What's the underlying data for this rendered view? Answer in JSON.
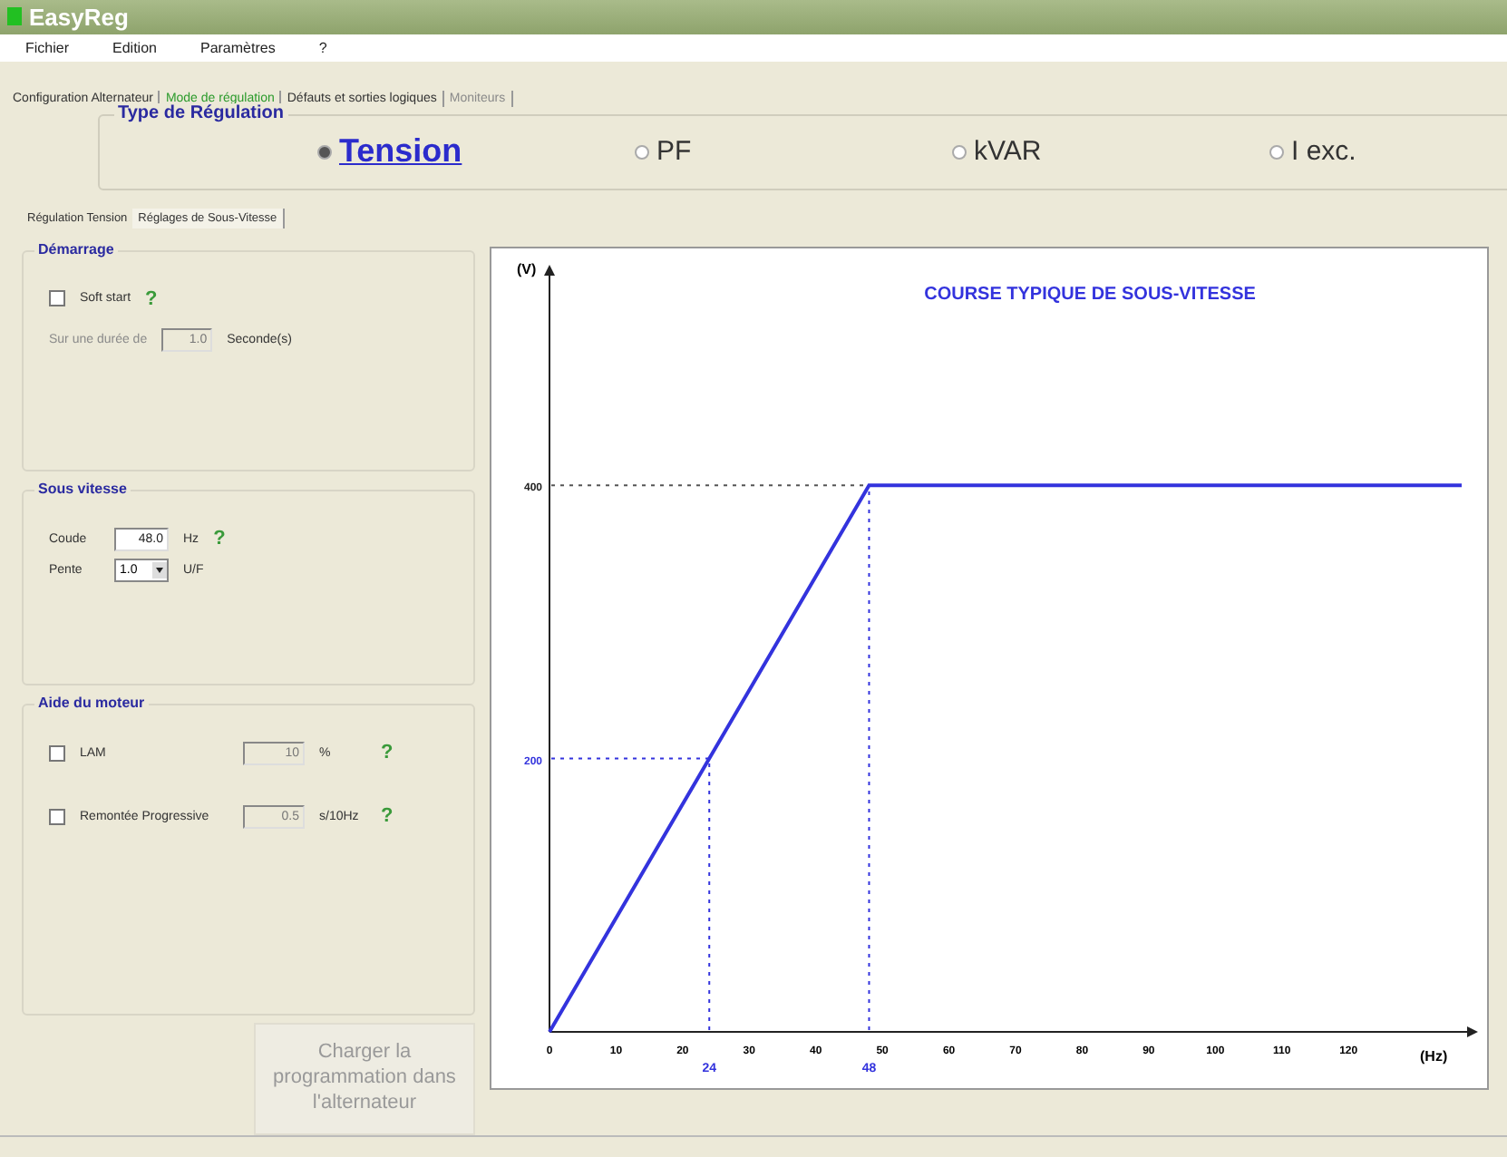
{
  "window": {
    "title": "EasyReg"
  },
  "menu": [
    "Fichier",
    "Edition",
    "Paramètres",
    "?"
  ],
  "tabs": [
    {
      "label": "Configuration Alternateur",
      "selected": false,
      "disabled": false
    },
    {
      "label": "Mode de régulation",
      "selected": true,
      "disabled": false
    },
    {
      "label": "Défauts et sorties logiques",
      "selected": false,
      "disabled": false
    },
    {
      "label": "Moniteurs",
      "selected": false,
      "disabled": true
    }
  ],
  "regulation_type": {
    "title": "Type de Régulation",
    "options": [
      {
        "label": "Tension",
        "selected": true
      },
      {
        "label": "PF",
        "selected": false
      },
      {
        "label": "kVAR",
        "selected": false
      },
      {
        "label": "I exc.",
        "selected": false
      }
    ]
  },
  "subtabs": [
    {
      "label": "Régulation Tension",
      "selected": false
    },
    {
      "label": "Réglages de Sous-Vitesse",
      "selected": true
    }
  ],
  "demarrage": {
    "title": "Démarrage",
    "soft_start": {
      "label": "Soft start",
      "checked": false
    },
    "help": "?",
    "duration_label": "Sur une durée de",
    "duration_value": "1.0",
    "duration_unit": "Seconde(s)"
  },
  "sous_vitesse": {
    "title": "Sous vitesse",
    "coude_label": "Coude",
    "coude_value": "48.0",
    "coude_unit": "Hz",
    "help": "?",
    "pente_label": "Pente",
    "pente_value": "1.0",
    "pente_unit": "U/F"
  },
  "aide_moteur": {
    "title": "Aide du moteur",
    "rows": [
      {
        "label": "LAM",
        "checked": false,
        "value": "10",
        "unit": "%",
        "help": "?"
      },
      {
        "label": "Remontée Progressive",
        "checked": false,
        "value": "0.5",
        "unit": "s/10Hz",
        "help": "?"
      }
    ]
  },
  "load_button": {
    "label": "Charger la programmation dans l'alternateur",
    "disabled": true
  },
  "chart": {
    "chart_data": {
      "type": "line",
      "title": "COURSE TYPIQUE DE SOUS-VITESSE",
      "xlabel": "(Hz)",
      "ylabel": "(V)",
      "x": [
        0,
        24,
        48,
        137
      ],
      "series": [
        {
          "color": "#3333dd",
          "values": [
            0,
            200,
            400,
            400
          ]
        }
      ],
      "xlim": [
        0,
        137
      ],
      "ylim": [
        0,
        560
      ],
      "xticks": [
        0,
        10,
        20,
        30,
        40,
        50,
        60,
        70,
        80,
        90,
        100,
        110,
        120
      ],
      "yticks": [
        200,
        400
      ],
      "annotations": [
        "24",
        "48"
      ],
      "ref_lines": [
        {
          "axis": "y",
          "value": 200,
          "color": "#3333dd"
        },
        {
          "axis": "y",
          "value": 400,
          "color": "#555555"
        },
        {
          "axis": "x",
          "value": 24,
          "color": "#3333dd"
        },
        {
          "axis": "x",
          "value": 48,
          "color": "#3333dd"
        }
      ]
    }
  }
}
